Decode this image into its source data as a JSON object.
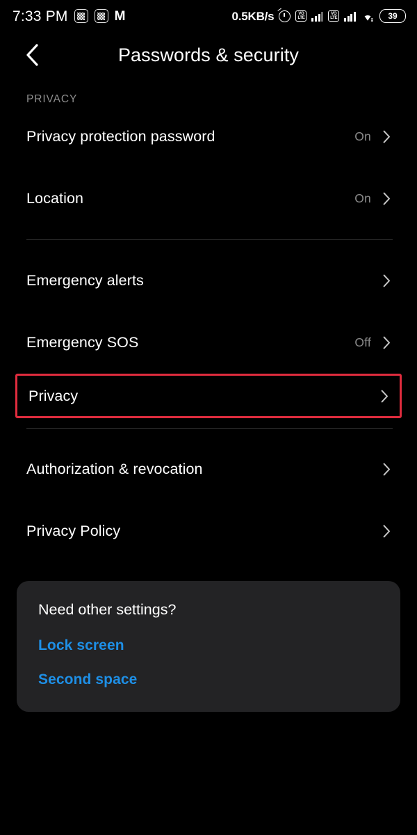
{
  "status_bar": {
    "time": "7:33 PM",
    "app_icon_1": "calculator-app-icon",
    "app_icon_2": "calculator-app-icon",
    "brand_logo": "M",
    "network_speed": "0.5KB/s",
    "alarm_icon": "alarm-clock-icon",
    "sim1_volte_top": "VO",
    "sim1_volte_bottom": "LTE",
    "sim2_volte_top": "VO",
    "sim2_volte_bottom": "LTE",
    "wifi_icon": "wifi-icon",
    "battery_level": "39"
  },
  "header": {
    "back_icon": "back-chevron-icon",
    "title": "Passwords & security"
  },
  "section": {
    "label": "PRIVACY"
  },
  "groups": [
    {
      "rows": [
        {
          "label": "Privacy protection password",
          "value": "On",
          "chevron": "chevron-right-icon",
          "highlighted": false
        },
        {
          "label": "Location",
          "value": "On",
          "chevron": "chevron-right-icon",
          "highlighted": false
        }
      ]
    },
    {
      "rows": [
        {
          "label": "Emergency alerts",
          "value": "",
          "chevron": "chevron-right-icon",
          "highlighted": false
        },
        {
          "label": "Emergency SOS",
          "value": "Off",
          "chevron": "chevron-right-icon",
          "highlighted": false
        },
        {
          "label": "Privacy",
          "value": "",
          "chevron": "chevron-right-icon",
          "highlighted": true
        }
      ]
    },
    {
      "rows": [
        {
          "label": "Authorization & revocation",
          "value": "",
          "chevron": "chevron-right-icon",
          "highlighted": false
        },
        {
          "label": "Privacy Policy",
          "value": "",
          "chevron": "chevron-right-icon",
          "highlighted": false
        }
      ]
    }
  ],
  "card": {
    "title": "Need other settings?",
    "links": [
      {
        "label": "Lock screen"
      },
      {
        "label": "Second space"
      }
    ]
  },
  "colors": {
    "background": "#000000",
    "card_background": "#232325",
    "text_primary": "#ffffff",
    "text_secondary": "#8a8a8a",
    "link_blue": "#1e8fe6",
    "highlight_red": "#e02c3e",
    "divider": "#2d2d2d"
  }
}
